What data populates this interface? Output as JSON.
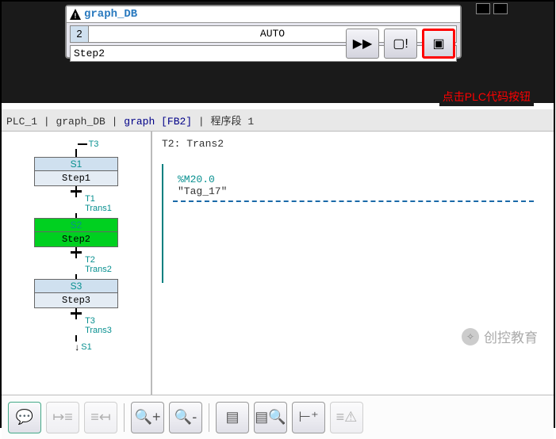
{
  "titlebar": {
    "label": "graph_DB"
  },
  "fields": {
    "num": "2",
    "auto": "AUTO",
    "step": "Step2"
  },
  "annotation": "点击PLC代码按钮",
  "breadcrumb": {
    "b1": "PLC_1",
    "b2": "graph_DB",
    "b3": "graph [FB2]",
    "b4": "程序段 1",
    "sep": " | "
  },
  "graph": {
    "t_in": "T3",
    "steps": [
      {
        "id": "S1",
        "name": "Step1",
        "active": false
      },
      {
        "id": "S2",
        "name": "Step2",
        "active": true
      },
      {
        "id": "S3",
        "name": "Step3",
        "active": false
      }
    ],
    "transitions": [
      {
        "id": "T1",
        "name": "Trans1"
      },
      {
        "id": "T2",
        "name": "Trans2"
      },
      {
        "id": "T3",
        "name": "Trans3"
      }
    ],
    "t_out": "S1"
  },
  "right": {
    "title": "T2: Trans2",
    "address": "%M20.0",
    "tag": "\"Tag_17\""
  },
  "icons": {
    "play": "▶▶",
    "alert": "⚠",
    "plc": "▣"
  },
  "watermark": {
    "text": "创控教育"
  },
  "chart_data": {
    "type": "table",
    "title": "Sequential Function Chart (GRAPH)",
    "steps": [
      "S1/Step1",
      "S2/Step2 (active)",
      "S3/Step3"
    ],
    "transitions": [
      "T1/Trans1",
      "T2/Trans2",
      "T3/Trans3"
    ],
    "entry": "T3",
    "exit": "S1",
    "monitored_transition": {
      "name": "T2: Trans2",
      "condition_tag": "Tag_17",
      "condition_address": "%M20.0"
    }
  }
}
